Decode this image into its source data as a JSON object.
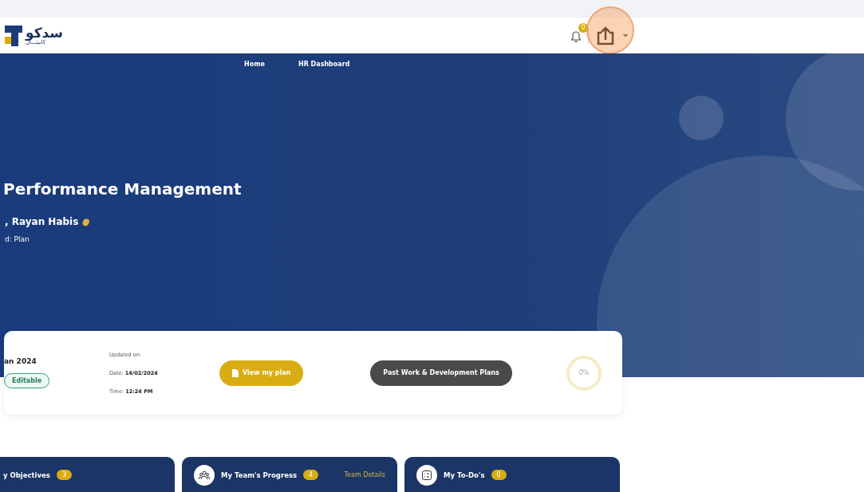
{
  "header": {
    "logo_text": "سدكو",
    "logo_subtext": "كابيتـــال",
    "notification_count": "0"
  },
  "nav": [
    {
      "label": "Home",
      "selected": false
    },
    {
      "label": "HR Dashboard",
      "selected": false
    }
  ],
  "hero": {
    "title": "Performance Management",
    "greeting": ", Rayan Habis",
    "period": "d: Plan"
  },
  "plan_card": {
    "title": "an 2024",
    "status": "Editable",
    "updated_label": "Updated on:",
    "date_label": "Date:",
    "date": "14/02/2024",
    "time_label": "Time:",
    "time": "12:24 PM",
    "view_button": "View my plan",
    "past_button": "Past Work & Development Plans",
    "progress": "0%"
  },
  "cards": [
    {
      "title": "y Objectives",
      "count": "3",
      "kind": "plain"
    },
    {
      "title": "My Team's Progress",
      "count": "4",
      "kind": "team",
      "link": "Team Details"
    },
    {
      "title": "My To-Do's",
      "count": "0",
      "kind": "todo"
    }
  ]
}
